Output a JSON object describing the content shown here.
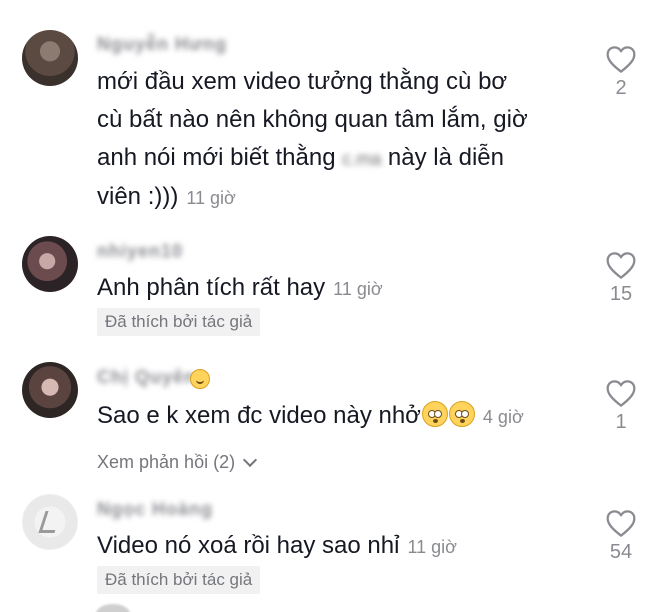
{
  "comments": [
    {
      "username": "Nguyễn Hưng",
      "text_parts": [
        "mới đầu xem video tưởng thằng cù bơ",
        "cù bất nào nên không quan tâm lắm, giờ",
        "anh nói mới biết thằng ",
        " này là diễn",
        "viên :)))"
      ],
      "hidden_word": "c.ma",
      "time": "11 giờ",
      "likes": "2"
    },
    {
      "username": "nhiyen10",
      "text": "Anh phân tích rất hay",
      "time": "11 giờ",
      "badge": "Đã thích bởi tác giả",
      "likes": "15"
    },
    {
      "username": "Chị Quyên",
      "text": "Sao e k xem đc video này nhở",
      "time": "4 giờ",
      "replies_label": "Xem phản hồi (2)",
      "likes": "1"
    },
    {
      "username": "Ngọc Hoàng",
      "text": "Video nó xoá rồi hay sao nhỉ",
      "time": "11 giờ",
      "badge": "Đã thích bởi tác giả",
      "likes": "54"
    }
  ]
}
